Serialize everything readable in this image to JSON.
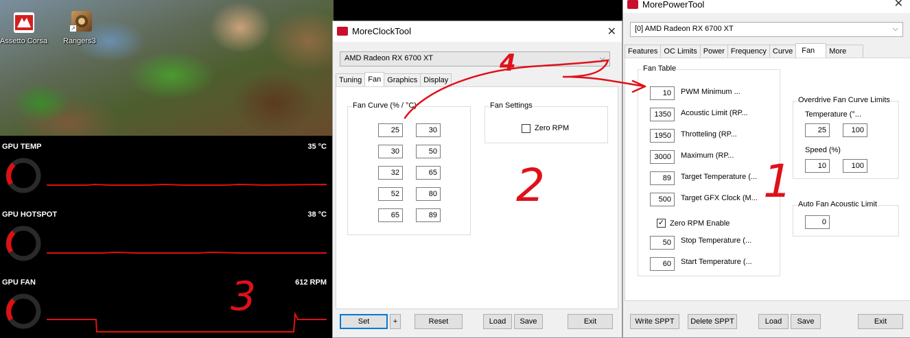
{
  "desktop": {
    "icons": [
      {
        "label": "Assetto Corsa",
        "icon": "assetto-corsa-icon",
        "color": "#d42020"
      },
      {
        "label": "Rangers3",
        "icon": "rangers3-icon",
        "color": "#8a5a2a"
      }
    ]
  },
  "monitor": {
    "accent": "#e01010",
    "rows": [
      {
        "title": "GPU TEMP",
        "value": "35 °C"
      },
      {
        "title": "GPU HOTSPOT",
        "value": "38 °C"
      },
      {
        "title": "GPU FAN",
        "value": "612 RPM"
      }
    ]
  },
  "mct": {
    "title": "MoreClockTool",
    "close": "✕",
    "device": "AMD Radeon RX 6700 XT",
    "tabs": [
      "Tuning",
      "Fan",
      "Graphics",
      "Display"
    ],
    "active_tab": "Fan",
    "fan_curve_label": "Fan Curve (% / °C)",
    "curve": [
      {
        "pct": "25",
        "temp": "30"
      },
      {
        "pct": "30",
        "temp": "50"
      },
      {
        "pct": "32",
        "temp": "65"
      },
      {
        "pct": "52",
        "temp": "80"
      },
      {
        "pct": "65",
        "temp": "89"
      }
    ],
    "fan_settings_label": "Fan Settings",
    "zero_rpm_label": "Zero RPM",
    "zero_rpm_checked": false,
    "buttons": {
      "set": "Set",
      "plus": "+",
      "reset": "Reset",
      "load": "Load",
      "save": "Save",
      "exit": "Exit"
    }
  },
  "mpt": {
    "title": "MorePowerTool",
    "close": "✕",
    "device": "[0] AMD Radeon RX 6700 XT",
    "tabs": [
      "Features",
      "OC Limits",
      "Power",
      "Frequency",
      "Curve",
      "Fan",
      "More"
    ],
    "active_tab": "Fan",
    "fan_table_label": "Fan Table",
    "fan_table": [
      {
        "value": "10",
        "label": "PWM Minimum ..."
      },
      {
        "value": "1350",
        "label": "Acoustic Limit (RP..."
      },
      {
        "value": "1950",
        "label": "Throtteling (RP..."
      },
      {
        "value": "3000",
        "label": "Maximum (RP..."
      },
      {
        "value": "89",
        "label": "Target Temperature (..."
      },
      {
        "value": "500",
        "label": "Target GFX Clock (M..."
      }
    ],
    "zero_rpm_enable_label": "Zero RPM Enable",
    "zero_rpm_enable_checked": true,
    "stop_temp": {
      "value": "50",
      "label": "Stop Temperature (..."
    },
    "start_temp": {
      "value": "60",
      "label": "Start Temperature (..."
    },
    "od_label": "Overdrive Fan Curve Limits",
    "od_temp_label": "Temperature (°...",
    "od_temp_min": "25",
    "od_temp_max": "100",
    "od_speed_label": "Speed (%)",
    "od_speed_min": "10",
    "od_speed_max": "100",
    "auto_label": "Auto Fan Acoustic Limit",
    "auto_value": "0",
    "buttons": {
      "write": "Write SPPT",
      "delete": "Delete SPPT",
      "load": "Load",
      "save": "Save",
      "exit": "Exit"
    }
  },
  "annotations": {
    "color": "#e0101a",
    "n1": "1",
    "n2": "2",
    "n3": "3",
    "n4": "4"
  }
}
